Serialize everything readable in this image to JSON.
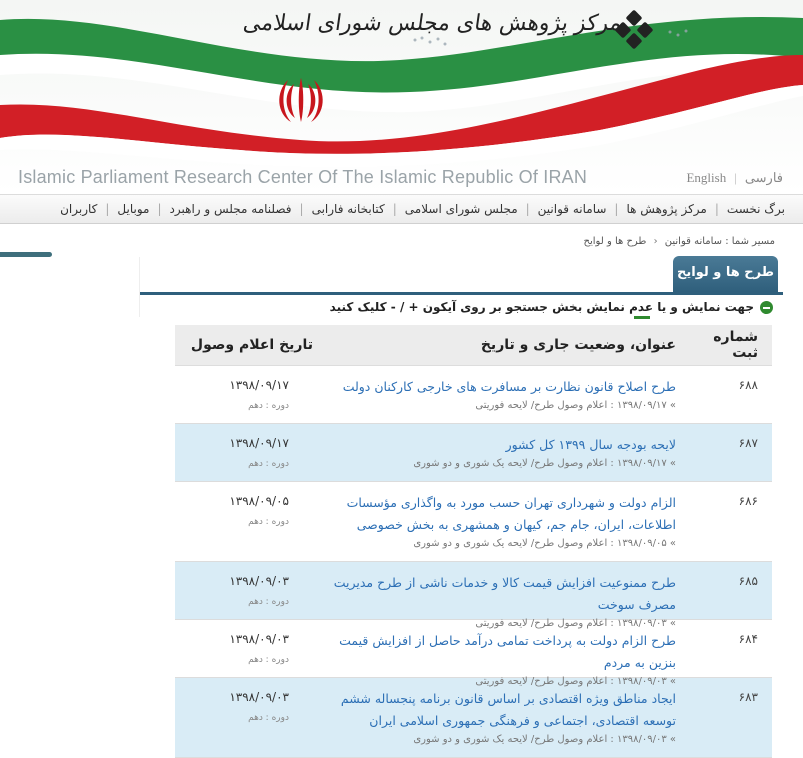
{
  "header": {
    "site_title": "Islamic Parliament Research Center Of The Islamic Republic Of IRAN",
    "logo_line1": "مرکز پژوهش های مجلس شورای اسلامی",
    "lang_english": "English",
    "lang_farsi": "فارسی",
    "flag_colors": {
      "green": "#1f8a3a",
      "red": "#d21f26"
    }
  },
  "nav": {
    "items": [
      {
        "label": "برگ نخست"
      },
      {
        "label": "مرکز پژوهش ها"
      },
      {
        "label": "سامانه قوانین"
      },
      {
        "label": "مجلس شورای اسلامی"
      },
      {
        "label": "کتابخانه فارابی"
      },
      {
        "label": "فصلنامه مجلس و راهبرد"
      },
      {
        "label": "موبایل"
      },
      {
        "label": "کاربران"
      }
    ]
  },
  "breadcrumb": {
    "prefix": "مسیر شما :",
    "item1": "سامانه قوانین",
    "item2": "طرح ها و لوایح"
  },
  "page": {
    "tab_title": "طرح ها و لوایح",
    "toggle_text": "جهت نمایش و یا عدم نمایش بخش جستجو بر روی آیکون + / - کلیک کنید"
  },
  "table": {
    "headers": {
      "number": "شماره ثبت",
      "title": "عنوان، وضعیت جاری و تاریخ",
      "date": "تاریخ اعلام وصول"
    },
    "rows": [
      {
        "number": "۶۸۸",
        "title": "طرح اصلاح قانون نظارت بر مسافرت های خارجی کارکنان دولت",
        "meta": "» ۱۳۹۸/۰۹/۱۷ : اعلام وصول طرح/ لایحه فوریتی",
        "date": "۱۳۹۸/۰۹/۱۷",
        "term": "دوره : دهم"
      },
      {
        "number": "۶۸۷",
        "title": "لایحه بودجه سال ۱۳۹۹ کل کشور",
        "meta": "» ۱۳۹۸/۰۹/۱۷ : اعلام وصول طرح/ لایحه یک شوری و دو شوری",
        "date": "۱۳۹۸/۰۹/۱۷",
        "term": "دوره : دهم"
      },
      {
        "number": "۶۸۶",
        "title": "الزام دولت و شهرداری تهران حسب مورد به واگذاری مؤسسات اطلاعات، ایران، جام جم، کیهان و همشهری به بخش خصوصی",
        "meta": "» ۱۳۹۸/۰۹/۰۵ : اعلام وصول طرح/ لایحه یک شوری و دو شوری",
        "date": "۱۳۹۸/۰۹/۰۵",
        "term": "دوره : دهم"
      },
      {
        "number": "۶۸۵",
        "title": "طرح ممنوعیت افزایش قیمت کالا و خدمات ناشی از طرح مدیریت مصرف سوخت",
        "meta": "» ۱۳۹۸/۰۹/۰۳ : اعلام وصول طرح/ لایحه فوریتی",
        "date": "۱۳۹۸/۰۹/۰۳",
        "term": "دوره : دهم"
      },
      {
        "number": "۶۸۴",
        "title": "طرح الزام دولت به پرداخت تمامی درآمد حاصل از افزایش قیمت بنزین به مردم",
        "meta": "» ۱۳۹۸/۰۹/۰۳ : اعلام وصول طرح/ لایحه فوریتی",
        "date": "۱۳۹۸/۰۹/۰۳",
        "term": "دوره : دهم"
      },
      {
        "number": "۶۸۳",
        "title": "ایجاد مناطق ویژه اقتصادی بر اساس قانون برنامه پنجساله ششم توسعه اقتصادی، اجتماعی و فرهنگی جمهوری اسلامی ایران",
        "meta": "» ۱۳۹۸/۰۹/۰۳ : اعلام وصول طرح/ لایحه یک شوری و دو شوری",
        "date": "۱۳۹۸/۰۹/۰۳",
        "term": "دوره : دهم"
      }
    ]
  }
}
